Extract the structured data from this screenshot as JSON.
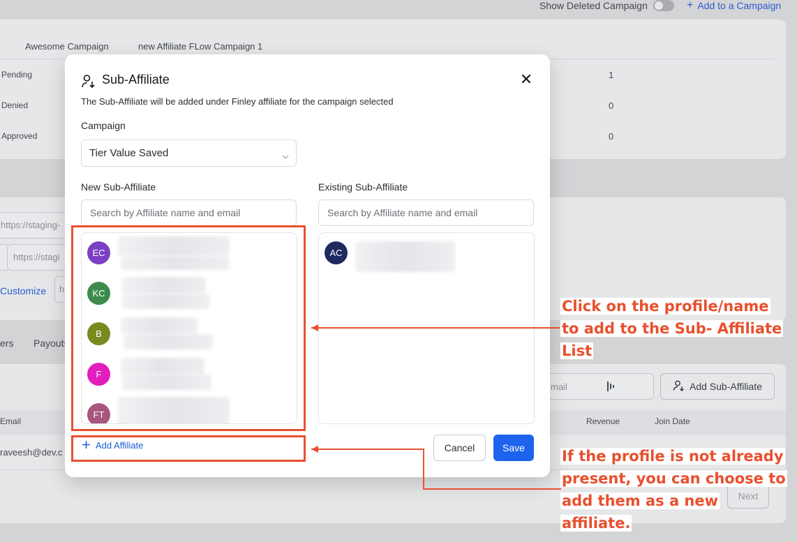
{
  "background": {
    "show_deleted_label": "Show Deleted Campaign",
    "add_campaign_label": "Add to a Campaign",
    "campaign_tabs": [
      "Awesome Campaign",
      "new Affiliate FLow Campaign 1"
    ],
    "status_rows": [
      {
        "label": "Pending",
        "value": "1"
      },
      {
        "label": "Denied",
        "value": "0"
      },
      {
        "label": "Approved",
        "value": "0"
      }
    ],
    "url_fragment_1": "https://staging-",
    "url_fragment_2": "https://stagi",
    "customize_label": "Customize",
    "customize_suffix": "h",
    "tab_partial_1": "ers",
    "tab_partial_2": "Payouts",
    "search_partial": "mail",
    "add_sub_affiliate_label": "Add Sub-Affiliate",
    "column_email": "Email",
    "column_revenue": "Revenue",
    "column_join_date": "Join Date",
    "email_partial": "raveesh@dev.c",
    "next_label": "Next"
  },
  "modal": {
    "title": "Sub-Affiliate",
    "description": "The Sub-Affiliate will be added under Finley affiliate for the campaign selected",
    "campaign_label": "Campaign",
    "campaign_value": "Tier Value Saved",
    "new_label": "New Sub-Affiliate",
    "existing_label": "Existing Sub-Affiliate",
    "search_placeholder": "Search by Affiliate name and email",
    "new_list": [
      {
        "initials": "EC",
        "color": "#7b3fc4"
      },
      {
        "initials": "KC",
        "color": "#3d8b4c"
      },
      {
        "initials": "B",
        "color": "#7a8a1f"
      },
      {
        "initials": "F",
        "color": "#e21fbd"
      },
      {
        "initials": "FT",
        "color": "#a8557f"
      }
    ],
    "existing_list": [
      {
        "initials": "AC",
        "color": "#1f2a5e"
      }
    ],
    "add_affiliate_label": "Add Affiliate",
    "cancel_label": "Cancel",
    "save_label": "Save"
  },
  "annotations": {
    "callout_1": [
      "Click on the profile/name",
      "to add to the Sub- Affiliate",
      "List"
    ],
    "callout_2": [
      "If the profile is not already",
      "present, you can choose to",
      "add them as a new",
      "affiliate."
    ],
    "accent_color": "#e85030"
  }
}
